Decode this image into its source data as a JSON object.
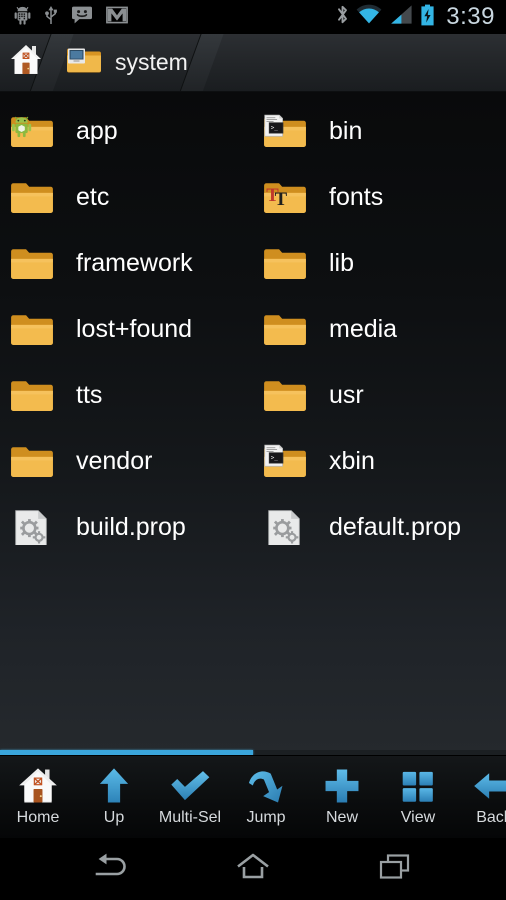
{
  "statusbar": {
    "left_icons": [
      "android-debug-icon",
      "usb-icon",
      "sms-icon",
      "gmail-icon"
    ],
    "right_icons": [
      "bluetooth-icon",
      "wifi-icon",
      "cell-signal-icon",
      "battery-charging-icon"
    ],
    "clock": "3:39",
    "clock_color": "#c9d7e0",
    "accent_color": "#33b5e5"
  },
  "breadcrumb": {
    "items": [
      {
        "label": "",
        "icon": "home-icon"
      },
      {
        "label": "system",
        "icon": "folder-system-icon"
      }
    ]
  },
  "files": [
    {
      "name": "app",
      "icon": "folder-android-icon"
    },
    {
      "name": "bin",
      "icon": "folder-terminal-icon"
    },
    {
      "name": "etc",
      "icon": "folder-icon"
    },
    {
      "name": "fonts",
      "icon": "folder-font-icon"
    },
    {
      "name": "framework",
      "icon": "folder-icon"
    },
    {
      "name": "lib",
      "icon": "folder-icon"
    },
    {
      "name": "lost+found",
      "icon": "folder-icon"
    },
    {
      "name": "media",
      "icon": "folder-icon"
    },
    {
      "name": "tts",
      "icon": "folder-icon"
    },
    {
      "name": "usr",
      "icon": "folder-icon"
    },
    {
      "name": "vendor",
      "icon": "folder-icon"
    },
    {
      "name": "xbin",
      "icon": "folder-terminal-icon"
    },
    {
      "name": "build.prop",
      "icon": "file-config-icon"
    },
    {
      "name": "default.prop",
      "icon": "file-config-icon"
    }
  ],
  "scrollbar": {
    "orientation": "horizontal",
    "thumb_color": "#3aa5dc",
    "thumb_fraction": 0.5
  },
  "toolbar": {
    "items": [
      {
        "label": "Home",
        "icon": "home-house-icon"
      },
      {
        "label": "Up",
        "icon": "arrow-up-icon"
      },
      {
        "label": "Multi-Sel",
        "icon": "checkmark-icon"
      },
      {
        "label": "Jump",
        "icon": "curved-arrow-icon"
      },
      {
        "label": "New",
        "icon": "plus-icon"
      },
      {
        "label": "View",
        "icon": "grid-view-icon"
      },
      {
        "label": "Back",
        "icon": "arrow-left-icon"
      }
    ],
    "accent_color": "#3c9fd6"
  },
  "navbar": {
    "items": [
      {
        "icon": "nav-back-icon"
      },
      {
        "icon": "nav-home-icon"
      },
      {
        "icon": "nav-recents-icon"
      }
    ],
    "color": "#9aa0a3"
  }
}
